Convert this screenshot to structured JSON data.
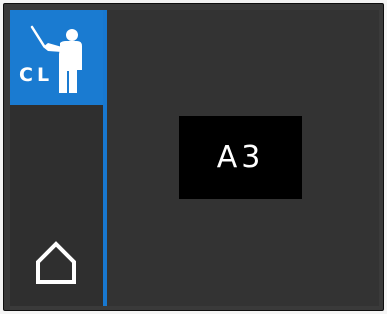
{
  "sidebar": {
    "mode_button": {
      "label": "CL",
      "icon": "teacher-pointer-icon"
    },
    "home_button": {
      "icon": "home-icon"
    }
  },
  "main": {
    "display_value": "A3"
  },
  "colors": {
    "accent": "#1a7bd1",
    "panel_background": "#333333",
    "display_background": "#000000",
    "foreground": "#ffffff"
  }
}
